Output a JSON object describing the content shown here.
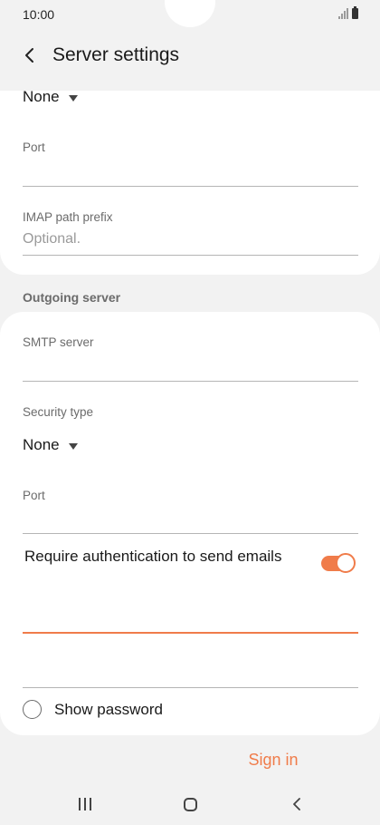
{
  "status_bar": {
    "time": "10:00"
  },
  "app_bar": {
    "title": "Server settings"
  },
  "incoming": {
    "security_value": "None",
    "port_label": "Port",
    "port_value": "",
    "imap_prefix_label": "IMAP path prefix",
    "imap_prefix_placeholder": "Optional."
  },
  "outgoing": {
    "section_title": "Outgoing server",
    "smtp_label": "SMTP server",
    "smtp_value": "",
    "security_label": "Security type",
    "security_value": "None",
    "port_label": "Port",
    "port_value": "",
    "require_auth_label": "Require authentication to send emails",
    "require_auth_on": true,
    "username_value": "",
    "password_value": "",
    "show_password_label": "Show password",
    "show_password_checked": false
  },
  "actions": {
    "sign_in_label": "Sign in"
  },
  "colors": {
    "accent": "#f07c4a",
    "background": "#f2f2f2",
    "card": "#ffffff",
    "label": "#6b6b6b"
  },
  "icons": [
    "back-arrow-icon",
    "signal-icon",
    "battery-icon",
    "caret-down-icon",
    "recents-icon",
    "home-icon",
    "nav-back-icon"
  ]
}
